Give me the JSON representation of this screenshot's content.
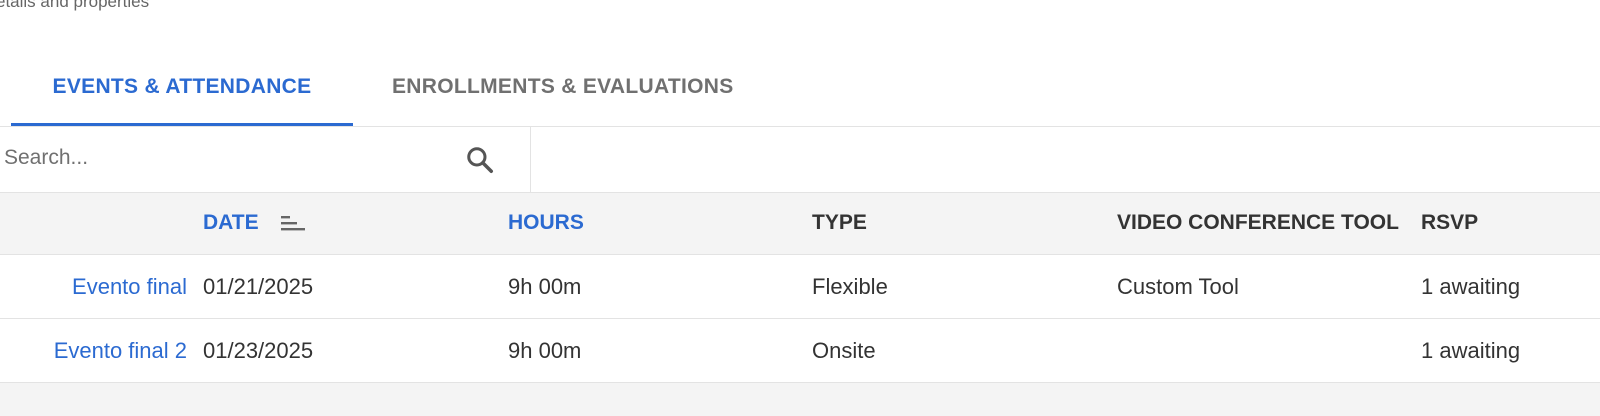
{
  "header": {
    "subtitle": "etails and properties"
  },
  "tabs": [
    {
      "label": "EVENTS & ATTENDANCE",
      "active": true
    },
    {
      "label": "ENROLLMENTS & EVALUATIONS",
      "active": false
    }
  ],
  "search": {
    "placeholder": "Search...",
    "value": ""
  },
  "table": {
    "columns": [
      {
        "label": "DATE",
        "sortable": true
      },
      {
        "label": "HOURS",
        "sortable": true
      },
      {
        "label": "TYPE",
        "sortable": false
      },
      {
        "label": "VIDEO CONFERENCE TOOL",
        "sortable": false
      },
      {
        "label": "RSVP",
        "sortable": false
      }
    ],
    "rows": [
      {
        "name": "Evento final",
        "date": "01/21/2025",
        "hours": "9h 00m",
        "type": "Flexible",
        "tool": "Custom Tool",
        "rsvp": "1 awaiting"
      },
      {
        "name": "Evento final 2",
        "date": "01/23/2025",
        "hours": "9h 00m",
        "type": "Onsite",
        "tool": "",
        "rsvp": "1 awaiting"
      }
    ]
  },
  "colors": {
    "accent": "#2b6ad1",
    "muted_text": "#707070",
    "header_bg": "#f4f4f4",
    "border": "#e3e3e3"
  },
  "icons": {
    "search": "search-icon",
    "sort": "sort-descending-icon"
  }
}
